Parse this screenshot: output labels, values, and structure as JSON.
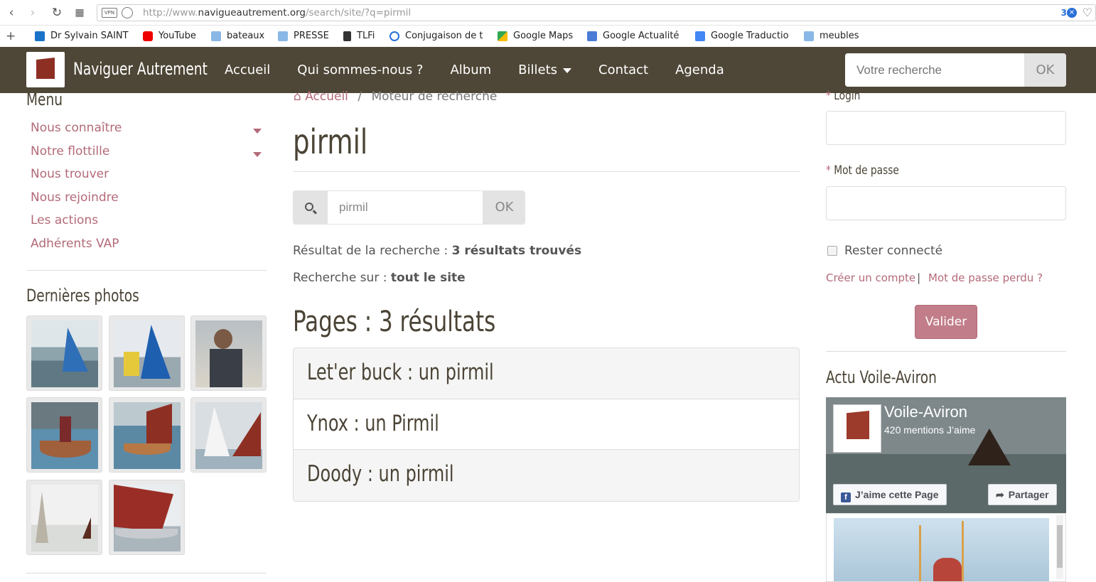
{
  "browser": {
    "url_prefix": "http://www.",
    "url_domain": "navigueautrement.org",
    "url_path": "/search/site/?q=pirmil",
    "vpn_label": "VPN",
    "tab_count": "3",
    "bookmarks": [
      {
        "label": "Dr Sylvain SAINT",
        "icon": "blue-swirl-icon"
      },
      {
        "label": "YouTube",
        "icon": "youtube-icon"
      },
      {
        "label": "bateaux",
        "icon": "folder-icon"
      },
      {
        "label": "PRESSE",
        "icon": "folder-icon"
      },
      {
        "label": "TLFi",
        "icon": "document-icon"
      },
      {
        "label": "Conjugaison de t",
        "icon": "conjugation-icon"
      },
      {
        "label": "Google Maps",
        "icon": "maps-icon"
      },
      {
        "label": "Google Actualité",
        "icon": "news-icon"
      },
      {
        "label": "Google Traductio",
        "icon": "translate-icon"
      },
      {
        "label": "meubles",
        "icon": "folder-icon"
      }
    ]
  },
  "site": {
    "brand": "Naviguer Autrement",
    "nav": [
      "Accueil",
      "Qui sommes-nous ?",
      "Album",
      "Billets",
      "Contact",
      "Agenda"
    ],
    "search_placeholder": "Votre recherche",
    "search_button": "OK"
  },
  "sidebar": {
    "menu_title": "Menu",
    "items": [
      {
        "label": "Nous connaître",
        "dropdown": true
      },
      {
        "label": "Notre flottille",
        "dropdown": true
      },
      {
        "label": "Nous trouver",
        "dropdown": false
      },
      {
        "label": "Nous rejoindre",
        "dropdown": false
      },
      {
        "label": "Les actions",
        "dropdown": false
      },
      {
        "label": "Adhérents VAP",
        "dropdown": false
      }
    ],
    "photos_title": "Dernières photos",
    "photo_count": 8
  },
  "main": {
    "breadcrumb_home": "Accueil",
    "breadcrumb_sep": "/",
    "breadcrumb_current": "Moteur de recherche",
    "title": "pirmil",
    "search_value": "pirmil",
    "search_button": "OK",
    "result_label": "Résultat de la recherche : ",
    "result_value": "3 résultats trouvés",
    "scope_label": "Recherche sur : ",
    "scope_value": "tout le site",
    "results_title": "Pages : 3 résultats",
    "results": [
      "Let'er buck : un pirmil",
      "Ynox : un Pirmil",
      "Doody : un pirmil"
    ]
  },
  "login": {
    "login_label": "Login",
    "password_label": "Mot de passe",
    "required_mark": "*",
    "remember_label": "Rester connecté",
    "create_account": "Créer un compte",
    "separator": "|",
    "forgot_password": "Mot de passe perdu ?",
    "submit": "Valider"
  },
  "actu": {
    "title": "Actu Voile-Aviron",
    "page_name": "Voile-Aviron",
    "likes": "420 mentions J’aime",
    "like_button": "J’aime cette Page",
    "share_button": "Partager"
  },
  "colors": {
    "navbar": "#4e4636",
    "link": "#b36a78",
    "submit": "#c17e8a"
  }
}
